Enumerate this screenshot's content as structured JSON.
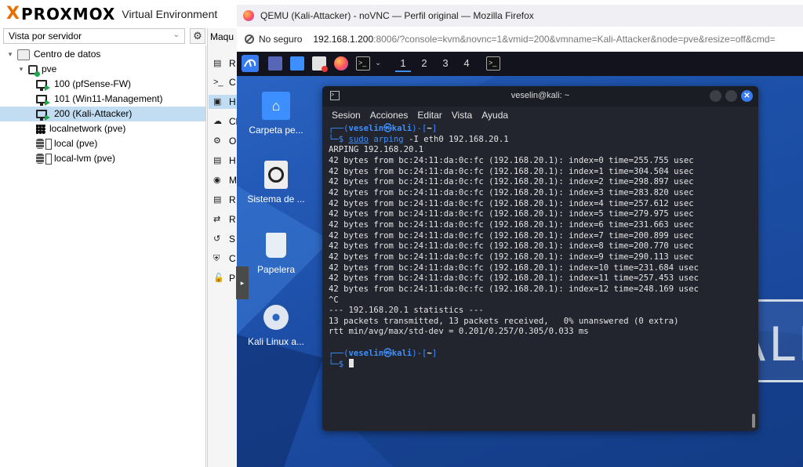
{
  "pve": {
    "logo_text": "PROXMOX",
    "subtitle": "Virtual Environment",
    "view_select": "Vista por servidor",
    "tree": [
      {
        "label": "Centro de datos",
        "type": "datacenter"
      },
      {
        "label": "pve",
        "type": "node"
      },
      {
        "label": "100 (pfSense-FW)",
        "type": "vm"
      },
      {
        "label": "101 (Win11-Management)",
        "type": "vm"
      },
      {
        "label": "200 (Kali-Attacker)",
        "type": "vm",
        "selected": true
      },
      {
        "label": "localnetwork (pve)",
        "type": "network"
      },
      {
        "label": "local (pve)",
        "type": "storage"
      },
      {
        "label": "local-lvm (pve)",
        "type": "storage"
      }
    ],
    "mid_tab": "Maqu",
    "mid_items": [
      "R",
      "C",
      "H",
      "Cl",
      "O",
      "H",
      "M",
      "R",
      "R",
      "S",
      "C",
      "P"
    ]
  },
  "firefox": {
    "window_title": "QEMU (Kali-Attacker) - noVNC — Perfil original — Mozilla Firefox",
    "security_label": "No seguro",
    "url_host": "192.168.1.200",
    "url_rest": ":8006/?console=kvm&novnc=1&vmid=200&vmname=Kali-Attacker&node=pve&resize=off&cmd="
  },
  "kali": {
    "workspaces": [
      "1",
      "2",
      "3",
      "4"
    ],
    "desktop_icons": [
      "Carpeta pe...",
      "Sistema de ...",
      "Papelera",
      "Kali Linux a..."
    ],
    "bg_text": "KALI"
  },
  "terminal": {
    "title": "veselin@kali: ~",
    "menu": [
      "Sesion",
      "Acciones",
      "Editar",
      "Vista",
      "Ayuda"
    ],
    "prompt_user": "veselin㉿kali",
    "prompt_path": "~",
    "cmd_sudo": "sudo",
    "cmd_arping": "arping",
    "cmd_args": " -I eth0 192.168.20.1",
    "header_line": "ARPING 192.168.20.1",
    "reply_lines": [
      "42 bytes from bc:24:11:da:0c:fc (192.168.20.1): index=0 time=255.755 usec",
      "42 bytes from bc:24:11:da:0c:fc (192.168.20.1): index=1 time=304.504 usec",
      "42 bytes from bc:24:11:da:0c:fc (192.168.20.1): index=2 time=298.897 usec",
      "42 bytes from bc:24:11:da:0c:fc (192.168.20.1): index=3 time=283.820 usec",
      "42 bytes from bc:24:11:da:0c:fc (192.168.20.1): index=4 time=257.612 usec",
      "42 bytes from bc:24:11:da:0c:fc (192.168.20.1): index=5 time=279.975 usec",
      "42 bytes from bc:24:11:da:0c:fc (192.168.20.1): index=6 time=231.663 usec",
      "42 bytes from bc:24:11:da:0c:fc (192.168.20.1): index=7 time=200.899 usec",
      "42 bytes from bc:24:11:da:0c:fc (192.168.20.1): index=8 time=200.770 usec",
      "42 bytes from bc:24:11:da:0c:fc (192.168.20.1): index=9 time=290.113 usec",
      "42 bytes from bc:24:11:da:0c:fc (192.168.20.1): index=10 time=231.684 usec",
      "42 bytes from bc:24:11:da:0c:fc (192.168.20.1): index=11 time=257.453 usec",
      "42 bytes from bc:24:11:da:0c:fc (192.168.20.1): index=12 time=248.169 usec"
    ],
    "interrupt": "^C",
    "stats_header": "--- 192.168.20.1 statistics ---",
    "stats_packets": "13 packets transmitted, 13 packets received,   0% unanswered (0 extra)",
    "stats_rtt": "rtt min/avg/max/std-dev = 0.201/0.257/0.305/0.033 ms"
  },
  "colors": {
    "proxmox_orange": "#e57000",
    "kali_blue": "#3d8eff",
    "selection": "#c2ddf2",
    "vm_running": "#1ea64b"
  }
}
